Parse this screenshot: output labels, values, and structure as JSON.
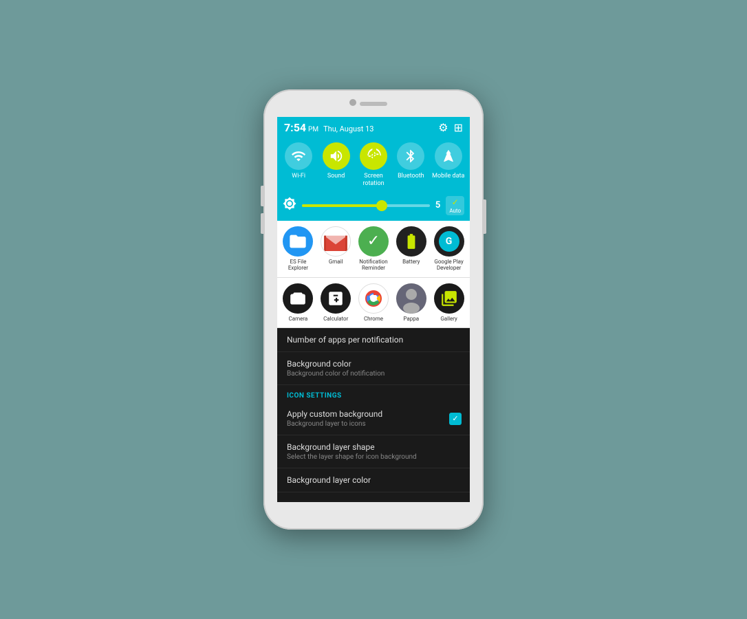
{
  "status_bar": {
    "time": "7:54",
    "time_period": "PM",
    "date": "Thu, August 13",
    "gear_label": "⚙",
    "grid_label": "⊞"
  },
  "quick_settings": {
    "tiles": [
      {
        "id": "wifi",
        "label": "Wi-Fi",
        "active": false
      },
      {
        "id": "sound",
        "label": "Sound",
        "active": true
      },
      {
        "id": "screen_rotation",
        "label": "Screen\nrotation",
        "active": true
      },
      {
        "id": "bluetooth",
        "label": "Bluetooth",
        "active": false
      },
      {
        "id": "mobile_data",
        "label": "Mobile\ndata",
        "active": false
      }
    ]
  },
  "brightness": {
    "value": "5",
    "auto_label": "Auto"
  },
  "apps_row1": [
    {
      "label": "ES File Explorer"
    },
    {
      "label": "Gmail"
    },
    {
      "label": "Notification\nReminder"
    },
    {
      "label": "Battery"
    },
    {
      "label": "Google Play\nDeveloper"
    }
  ],
  "apps_row2": [
    {
      "label": "Camera"
    },
    {
      "label": "Calculator"
    },
    {
      "label": "Chrome"
    },
    {
      "label": "Pappa"
    },
    {
      "label": "Gallery"
    }
  ],
  "settings": {
    "section_header": "ICON SETTINGS",
    "items": [
      {
        "title": "Number of apps per notification",
        "subtitle": ""
      },
      {
        "title": "Background color",
        "subtitle": "Background color of notification"
      },
      {
        "title": "Apply custom background",
        "subtitle": "Background layer to icons",
        "has_checkbox": true
      },
      {
        "title": "Background layer shape",
        "subtitle": "Select the layer shape for icon background"
      },
      {
        "title": "Background layer color",
        "subtitle": ""
      }
    ]
  }
}
